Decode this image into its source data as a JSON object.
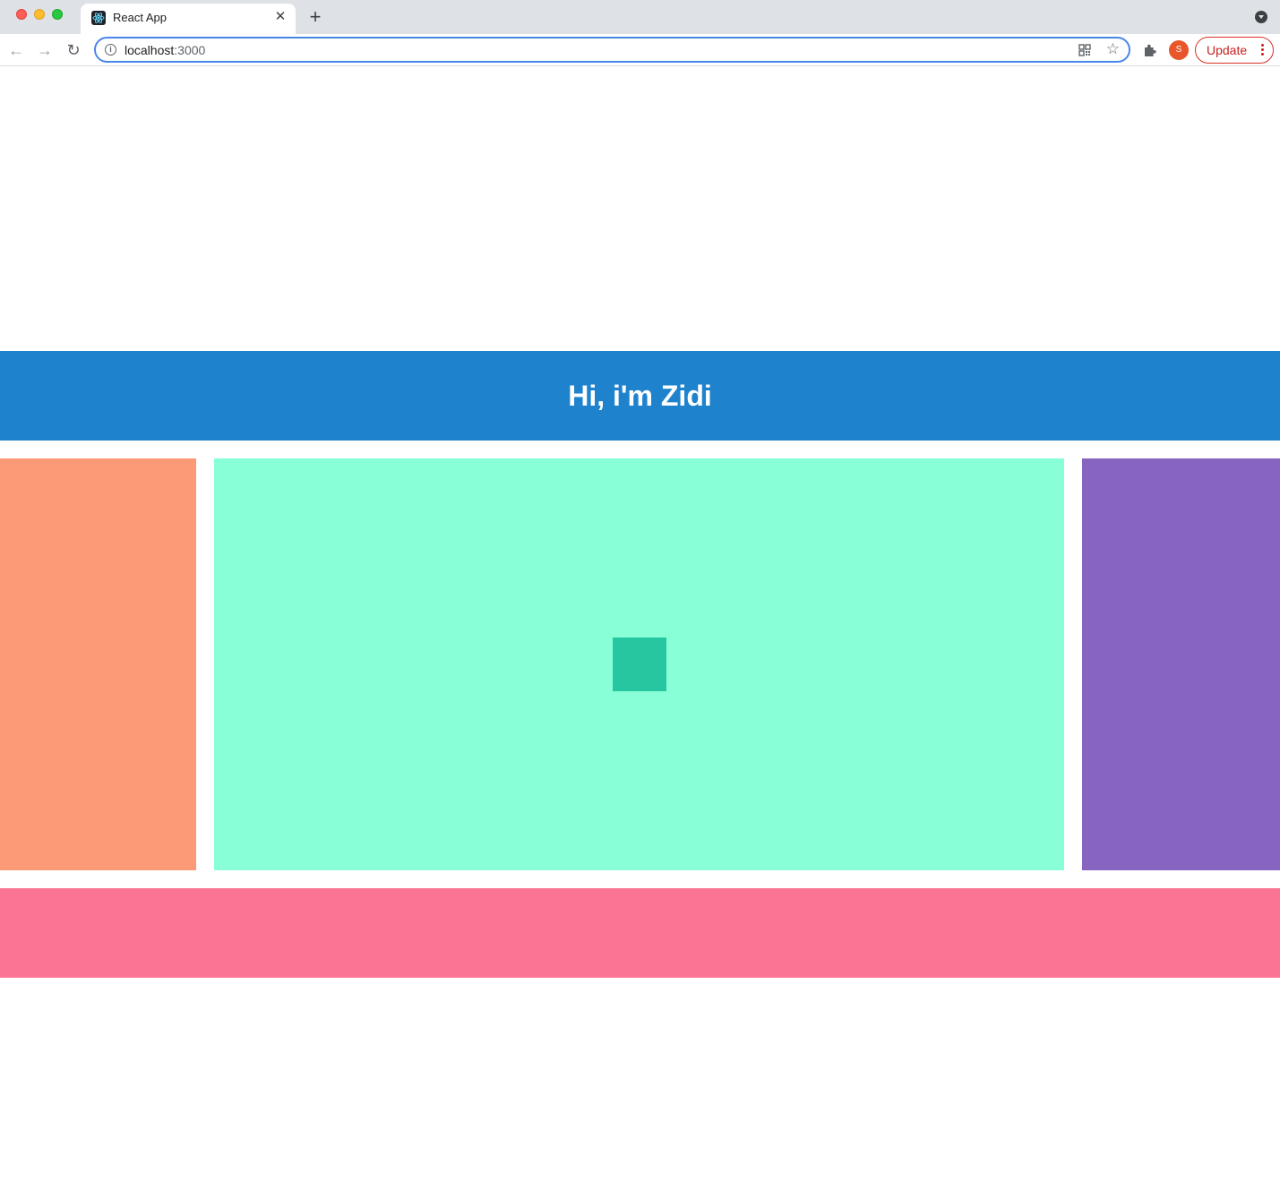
{
  "browser": {
    "tab": {
      "title": "React App",
      "close_glyph": "✕",
      "favicon": "react-icon"
    },
    "new_tab_glyph": "+",
    "nav": {
      "back_glyph": "←",
      "forward_glyph": "→",
      "reload_glyph": "↻"
    },
    "address": {
      "host": "localhost",
      "port": ":3000",
      "info_glyph": "i"
    },
    "star_glyph": "☆",
    "profile_initial": "S",
    "update_label": "Update"
  },
  "page": {
    "header_title": "Hi, i'm Zidi"
  },
  "colors": {
    "header": "#1e83cc",
    "left": "#fc9a77",
    "center": "#88ffd6",
    "inner_square": "#26c6a0",
    "right": "#8664c0",
    "footer": "#fb7493"
  }
}
